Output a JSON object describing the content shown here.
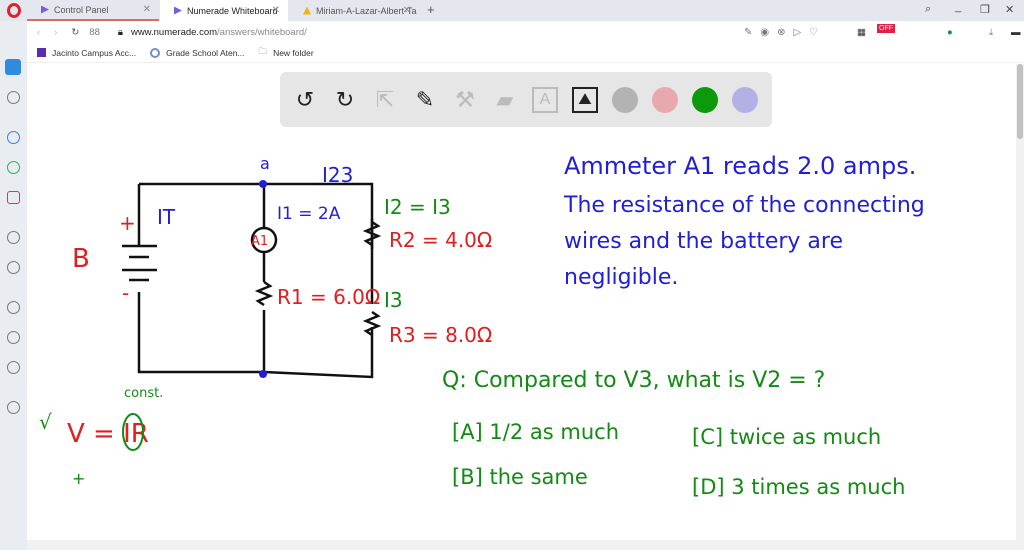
{
  "browser": {
    "tabs": [
      {
        "label": "Control Panel"
      },
      {
        "label": "Numerade Whiteboard",
        "active": true
      },
      {
        "label": "Miriam-A-Lazar-Albert-Ta"
      }
    ],
    "url_host": "www.numerade.com",
    "url_path": "/answers/whiteboard/",
    "bookmarks": [
      "Jacinto Campus Acc...",
      "Grade School Aten...",
      "New folder"
    ],
    "ext_badge": "OFF"
  },
  "toolbar": {
    "tools": [
      "undo-icon",
      "redo-icon",
      "select-icon",
      "pen-icon",
      "tools-icon",
      "eraser-icon",
      "text-icon",
      "image-icon"
    ],
    "colors": [
      "#b3b3b3",
      "#e8a9ae",
      "#0a9a0a",
      "#b3b0e6"
    ]
  },
  "board": {
    "colors": {
      "blue": "#1f1fd6",
      "red": "#e01e1e",
      "green": "#138a13",
      "black": "#111111"
    },
    "labels": {
      "a": "a",
      "I23": "I23",
      "IT": "IT",
      "B": "B",
      "plus": "+",
      "minus": "-",
      "I1": "I1 = 2A",
      "A1": "A1",
      "R1": "R1 = 6.0Ω",
      "I2": "I2 = I3",
      "R2": "R2 = 4.0Ω",
      "I3": "I3",
      "R3": "R3 = 8.0Ω",
      "const": "const.",
      "check": "√",
      "ohm": "V = IR"
    },
    "problem": [
      "Ammeter A1 reads 2.0 amps.",
      "The resistance of the connecting",
      "wires and the battery are",
      "negligible."
    ],
    "question": "Q: Compared to V3, what is V2 = ?",
    "choices": [
      "[A] 1/2 as much",
      "[B] the same",
      "[C] twice as much",
      "[D] 3 times as much"
    ],
    "cursor": "+"
  }
}
